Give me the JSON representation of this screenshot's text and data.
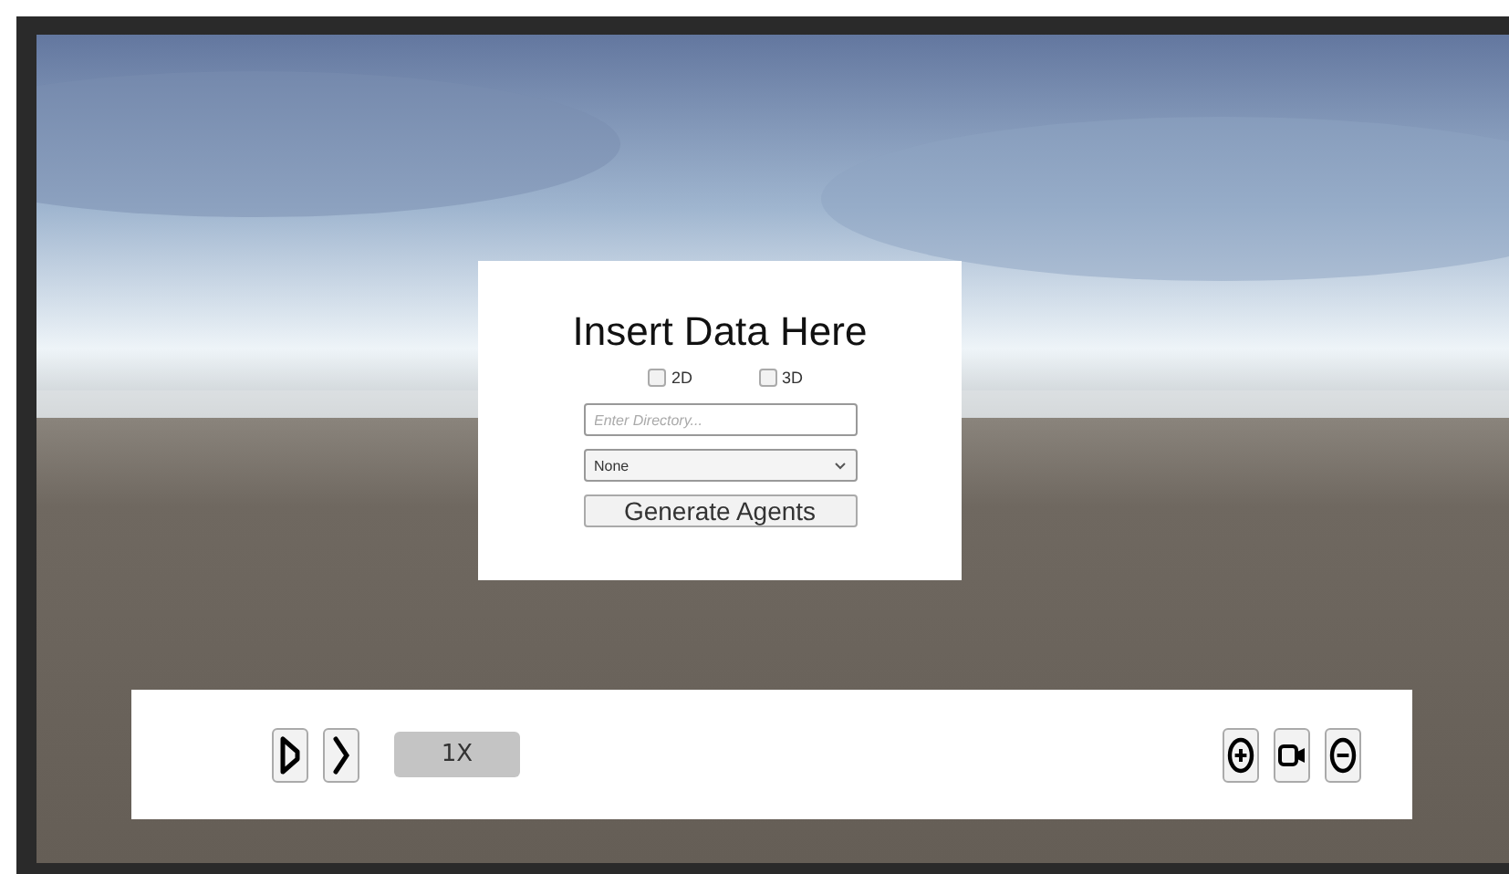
{
  "dialog": {
    "title": "Insert Data Here",
    "options": [
      {
        "label": "2D",
        "checked": false
      },
      {
        "label": "3D",
        "checked": false
      }
    ],
    "directory": {
      "placeholder": "Enter Directory..."
    },
    "dropdown": {
      "value": "None"
    },
    "button": "Generate Agents"
  },
  "playback": {
    "speed": "1X"
  }
}
